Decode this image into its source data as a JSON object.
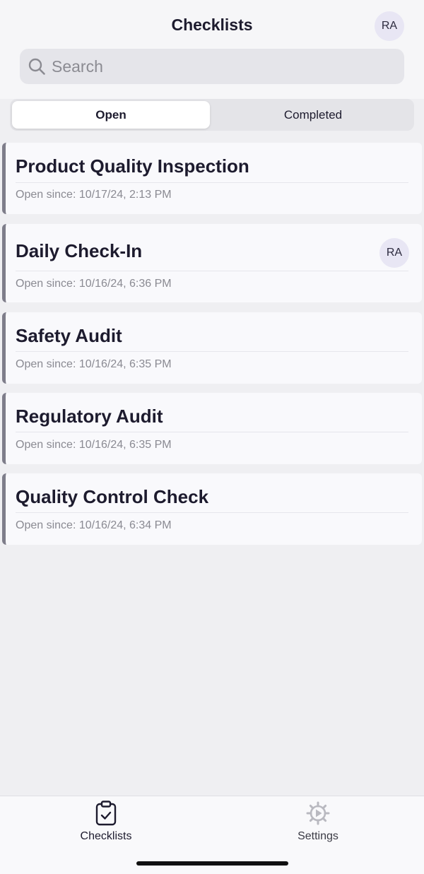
{
  "header": {
    "title": "Checklists",
    "avatar_initials": "RA"
  },
  "search": {
    "placeholder": "Search",
    "value": ""
  },
  "segment": {
    "options": [
      "Open",
      "Completed"
    ],
    "selected": "Open"
  },
  "checklists": [
    {
      "title": "Product Quality Inspection",
      "meta": "Open since:  10/17/24, 2:13 PM",
      "assignee": ""
    },
    {
      "title": "Daily Check-In",
      "meta": "Open since:  10/16/24, 6:36 PM",
      "assignee": "RA"
    },
    {
      "title": "Safety Audit",
      "meta": "Open since:  10/16/24, 6:35 PM",
      "assignee": ""
    },
    {
      "title": "Regulatory Audit",
      "meta": "Open since:  10/16/24, 6:35 PM",
      "assignee": ""
    },
    {
      "title": "Quality Control Check",
      "meta": "Open since:  10/16/24, 6:34 PM",
      "assignee": ""
    }
  ],
  "tabbar": {
    "tabs": [
      {
        "label": "Checklists",
        "icon": "clipboard-check-icon",
        "active": true
      },
      {
        "label": "Settings",
        "icon": "gear-icon",
        "active": false
      }
    ]
  },
  "colors": {
    "accent_bar": "#7e7d8a",
    "avatar_bg": "#e8e6f4",
    "background": "#efeff2"
  }
}
